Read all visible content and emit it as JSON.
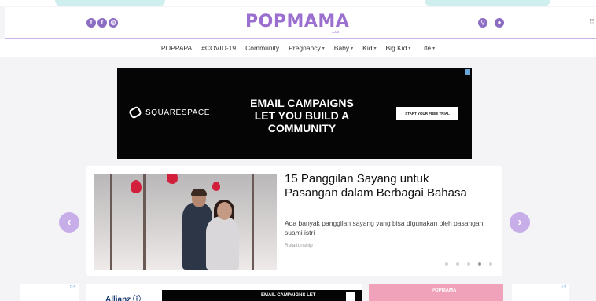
{
  "header": {
    "logo": "POPMAMA",
    "logo_sub": ".com",
    "social": [
      {
        "icon": "facebook-icon",
        "glyph": "f"
      },
      {
        "icon": "twitter-icon",
        "glyph": "t"
      },
      {
        "icon": "instagram-icon",
        "glyph": "◎"
      }
    ],
    "search_glyph": "⚲",
    "user_glyph": "●"
  },
  "nav": {
    "items": [
      {
        "label": "POPPAPA",
        "dropdown": false
      },
      {
        "label": "#COVID-19",
        "dropdown": false
      },
      {
        "label": "Community",
        "dropdown": false
      },
      {
        "label": "Pregnancy",
        "dropdown": true
      },
      {
        "label": "Baby",
        "dropdown": true
      },
      {
        "label": "Kid",
        "dropdown": true
      },
      {
        "label": "Big Kid",
        "dropdown": true
      },
      {
        "label": "Life",
        "dropdown": true
      }
    ],
    "caret": "▾"
  },
  "ad": {
    "brand": "SQUARESPACE",
    "headline": "EMAIL CAMPAIGNS LET YOU BUILD A COMMUNITY",
    "cta": "START YOUR FREE TRIAL"
  },
  "article": {
    "title": "15 Panggilan Sayang untuk Pasangan dalam Berbagai Bahasa",
    "description": "Ada banyak panggilan sayang yang bisa digunakan oleh pasangan suami istri",
    "category": "Relationship",
    "slide_index": 4,
    "slide_count": 5
  },
  "slider": {
    "prev_glyph": "‹",
    "next_glyph": "›"
  },
  "bottom": {
    "left_ad_label": "▷✕",
    "right_ad_label": "▷✕",
    "allianz": "Allianz ⓘ",
    "black_ad_text": "EMAIL CAMPAIGNS LET",
    "pink_text": "POPMAMA"
  }
}
